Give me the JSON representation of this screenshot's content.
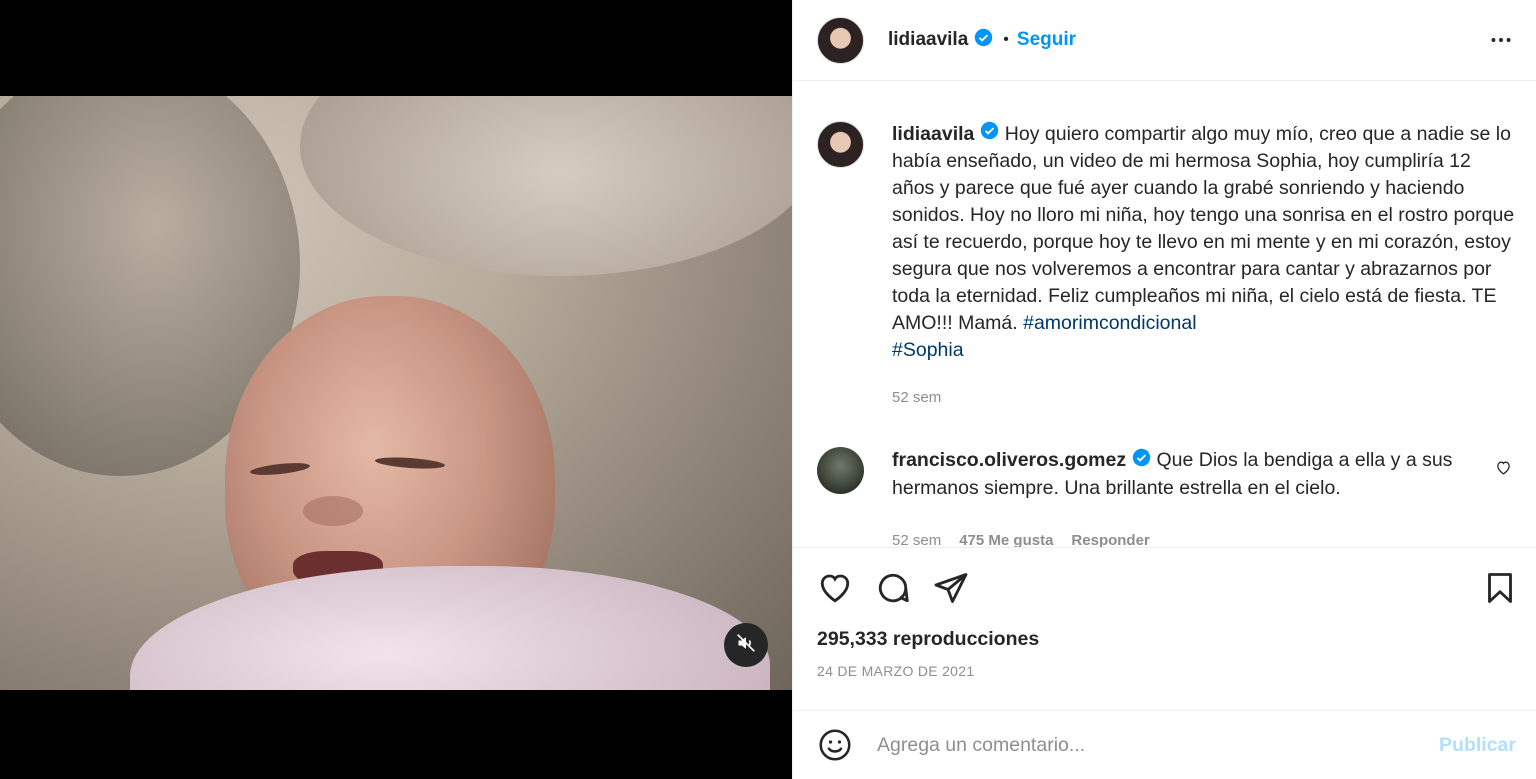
{
  "header": {
    "username": "lidiaavila",
    "separator": "•",
    "follow_label": "Seguir",
    "more_icon": "more-horizontal-icon",
    "verified_icon": "verified-badge-icon"
  },
  "caption": {
    "username": "lidiaavila",
    "text": " Hoy quiero compartir algo muy mío, creo que a nadie se lo había enseñado, un video de mi hermosa Sophia, hoy cumpliría 12 años y parece que fué ayer cuando la grabé sonriendo y haciendo sonidos. Hoy no lloro mi niña, hoy tengo una sonrisa en el rostro porque así te recuerdo, porque hoy te llevo en mi mente y en mi corazón, estoy segura que nos volveremos a encontrar para cantar y abrazarnos por toda la eternidad. Feliz cumpleaños mi niña, el cielo está de fiesta. TE AMO!!! Mamá. ",
    "hashtags": [
      "#amorimcondicional",
      "#Sophia"
    ],
    "time": "52 sem"
  },
  "comment": {
    "username": "francisco.oliveros.gomez",
    "text": " Que Dios la bendiga a ella y a sus hermanos siempre. Una brillante estrella en el cielo.",
    "time": "52 sem",
    "likes": "475 Me gusta",
    "reply_label": "Responder"
  },
  "actions": {
    "icons": [
      "heart-icon",
      "comment-icon",
      "share-icon",
      "bookmark-icon"
    ],
    "views": "295,333 reproducciones",
    "date": "24 DE MARZO DE 2021"
  },
  "add_comment": {
    "placeholder": "Agrega un comentario...",
    "publish_label": "Publicar"
  },
  "video": {
    "mute_icon": "muted-speaker-icon"
  },
  "colors": {
    "accent": "#0095f6",
    "hashtag": "#00376b",
    "muted_text": "#8e8e8e",
    "publish_disabled": "#b2dffc"
  }
}
